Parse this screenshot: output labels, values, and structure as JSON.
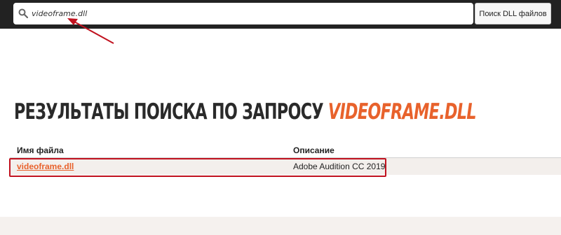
{
  "search": {
    "value": "videoframe.dll",
    "button_label": "Поиск DLL файлов"
  },
  "results": {
    "heading_prefix": "РЕЗУЛЬТАТЫ ПОИСКА ПО ЗАПРОСУ",
    "heading_query": "VIDEOFRAME.DLL",
    "columns": [
      "Имя файла",
      "Описание"
    ],
    "rows": [
      {
        "file": "videoframe.dll",
        "description": "Adobe Audition CC 2019"
      }
    ]
  },
  "colors": {
    "accent": "#e8622c",
    "topbar": "#222222",
    "annotation": "#c1121f",
    "row_background": "#f3efec"
  },
  "icons": {
    "search": "search-icon"
  }
}
